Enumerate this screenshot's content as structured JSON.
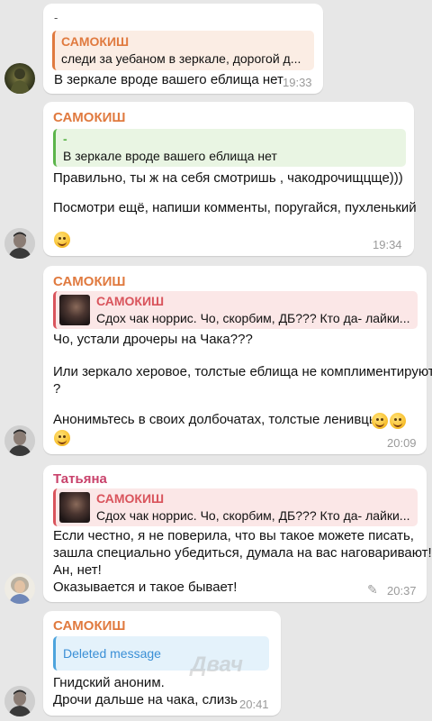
{
  "colors": {
    "background": "#e7e7e7",
    "sender_orange": "#e07a3f",
    "sender_pink": "#c9426b",
    "reply_orange": "#e07a3f",
    "reply_green": "#5cb54b",
    "reply_red": "#d9545c",
    "reply_blue": "#4ea4dd",
    "deleted_text": "#3a8fd6",
    "time": "#9a9a9a"
  },
  "messages": [
    {
      "reply": {
        "name": "САМОКИШ",
        "text": "следи за уебаном в зеркале, дорогой д..."
      },
      "top_text": "-",
      "lines": [
        "В зеркале вроде вашего еблища нет"
      ],
      "time": "19:33",
      "avatar": "avatar-military"
    },
    {
      "sender": "САМОКИШ",
      "reply": {
        "name": "-",
        "text": "В зеркале вроде вашего еблища нет"
      },
      "lines": [
        "Правильно, ты ж на себя смотришь , чакодрочищцще)))",
        "",
        "Посмотри ещё, напиши комменты, поругайся, пухленький"
      ],
      "emoji": "smiling-emoji",
      "time": "19:34",
      "avatar": "avatar-man"
    },
    {
      "sender": "САМОКИШ",
      "reply": {
        "name": "САМОКИШ",
        "text": "Сдох чак норрис.  Чо, скорбим, ДБ???  Кто да- лайки..."
      },
      "lines": [
        "Чо, устали дрочеры на Чака???",
        "",
        "Или зеркало херовое, толстые еблища не комплиментируют",
        "?",
        "",
        "Анонимьтесь в своих долбочатах, толстые ленивцы"
      ],
      "time": "20:09",
      "avatar": "avatar-man"
    },
    {
      "sender": "Татьяна",
      "reply": {
        "name": "САМОКИШ",
        "text": "Сдох чак норрис.  Чо, скорбим, ДБ???  Кто да- лайки..."
      },
      "lines": [
        "Если честно, я не поверила, что вы такое можете писать,",
        "зашла специально убедиться, думала на вас наговаривают!",
        "Ан, нет!",
        "Оказывается и такое бывает!"
      ],
      "time": "20:37",
      "edited_icon": "pencil-icon",
      "avatar": "avatar-woman"
    },
    {
      "sender": "САМОКИШ",
      "reply": {
        "name": "",
        "text": "Deleted message"
      },
      "lines": [
        "Гнидский аноним.",
        "Дрочи дальше на чака, слизь"
      ],
      "time": "20:41",
      "avatar": "avatar-man"
    }
  ],
  "watermark": "Двач"
}
